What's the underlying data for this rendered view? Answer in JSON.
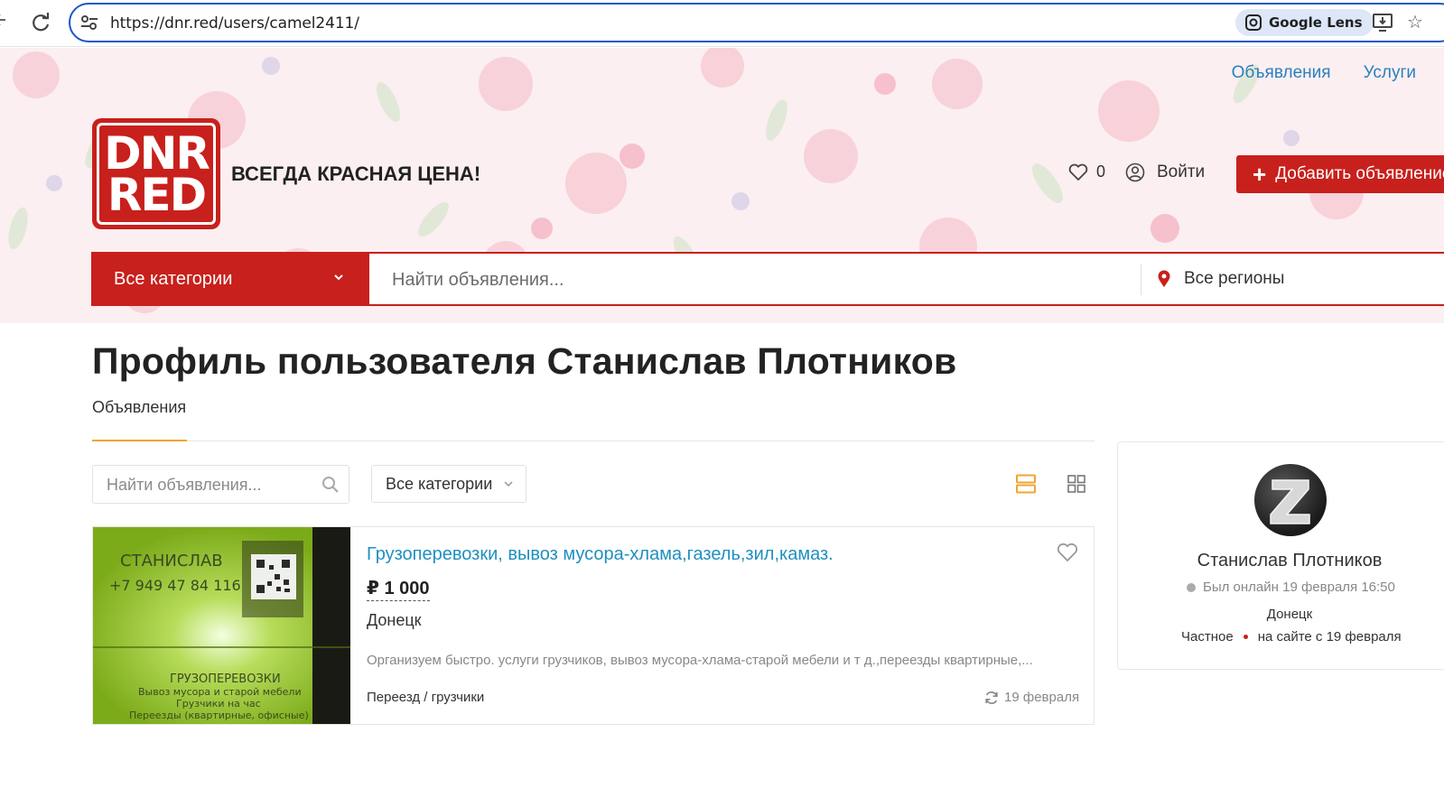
{
  "browser": {
    "url": "https://dnr.red/users/camel2411/",
    "lens_label": "Google Lens"
  },
  "header": {
    "nav": [
      "Объявления",
      "Услуги"
    ],
    "logo_lines": [
      "DNR",
      "RED"
    ],
    "tagline": "ВСЕГДА КРАСНАЯ ЦЕНА!",
    "favorites_count": "0",
    "login_label": "Войти",
    "add_button_label": "Добавить объявление",
    "search": {
      "category": "Все категории",
      "placeholder": "Найти объявления...",
      "region": "Все регионы"
    }
  },
  "profile": {
    "title": "Профиль пользователя Станислав Плотников",
    "tab": "Объявления",
    "filter_search_placeholder": "Найти объявления...",
    "filter_category": "Все категории"
  },
  "listing": {
    "title": "Грузоперевозки, вывоз мусора-хлама,газель,зил,камаз.",
    "price": "₽ 1 000",
    "city": "Донецк",
    "description": "Организуем быстро. услуги грузчиков, вывоз мусора-хлама-старой мебели и т д.,переезды квартирные,...",
    "category": "Переезд / грузчики",
    "date": "19 февраля",
    "photo_text": {
      "name": "СТАНИСЛАВ",
      "phone": "+7 949 47 84 116",
      "lines": [
        "ГРУЗОПЕРЕВОЗКИ",
        "Вывоз мусора и старой мебели",
        "Грузчики на час",
        "Переезды (квартирные, офисные)"
      ]
    }
  },
  "seller": {
    "name": "Станислав Плотников",
    "last_online": "Был онлайн 19 февраля 16:50",
    "city": "Донецк",
    "type": "Частное",
    "since": "на сайте с 19 февраля"
  },
  "colors": {
    "brand_red": "#c8201c",
    "link_blue": "#1f8fc0",
    "accent_orange": "#f0a52e"
  }
}
